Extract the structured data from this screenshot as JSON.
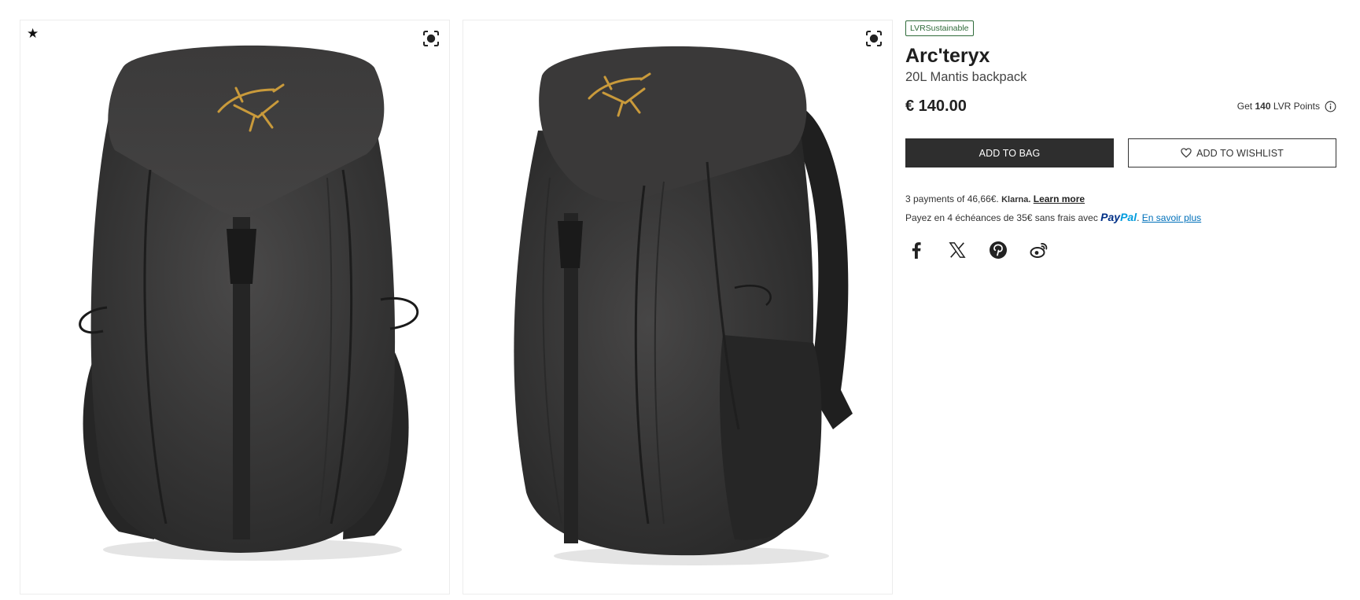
{
  "gallery": {
    "images": [
      {
        "alt": "Arc'teryx 20L Mantis backpack front view",
        "icon": "zoom-icon"
      },
      {
        "alt": "Arc'teryx 20L Mantis backpack side view",
        "icon": "zoom-icon"
      }
    ],
    "favorite_icon": "star-icon"
  },
  "product": {
    "badge": "LVRSustainable",
    "brand": "Arc'teryx",
    "name": "20L Mantis backpack",
    "price": "€ 140.00",
    "points_prefix": "Get",
    "points_value": "140",
    "points_suffix": "LVR Points"
  },
  "actions": {
    "add_to_bag": "ADD TO BAG",
    "add_to_wishlist": "ADD TO WISHLIST"
  },
  "payments": {
    "klarna_text": "3 payments of 46,66€.",
    "klarna_brand": "Klarna.",
    "klarna_link": "Learn more",
    "paypal_text": "Payez en 4 échéances de 35€ sans frais avec",
    "paypal_brand_1": "Pay",
    "paypal_brand_2": "Pal",
    "paypal_link": "En savoir plus"
  },
  "social": [
    "facebook-icon",
    "x-icon",
    "pinterest-icon",
    "weibo-icon"
  ],
  "colors": {
    "primary_button": "#2e2e2e",
    "badge_green": "#2f6b3a",
    "paypal_dark": "#003087",
    "paypal_light": "#009cde",
    "link_blue": "#0070ba"
  }
}
